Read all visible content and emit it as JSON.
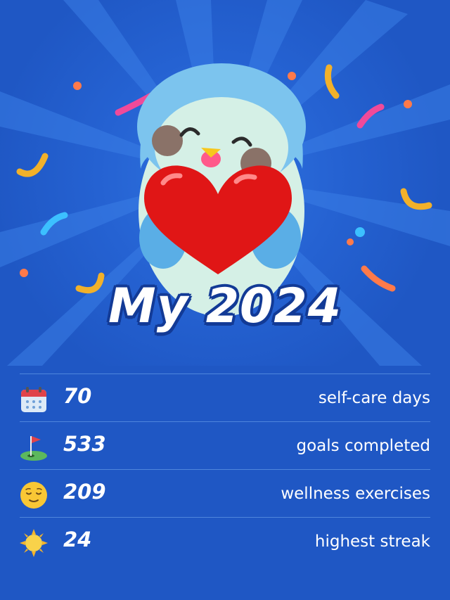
{
  "title": "My 2024",
  "stats": [
    {
      "icon": "calendar-icon",
      "value": "70",
      "label": "self-care days"
    },
    {
      "icon": "golf-flag-icon",
      "value": "533",
      "label": "goals completed"
    },
    {
      "icon": "relieved-face-icon",
      "value": "209",
      "label": "wellness exercises"
    },
    {
      "icon": "sun-icon",
      "value": "24",
      "label": "highest streak"
    }
  ],
  "colors": {
    "background": "#1f57c4",
    "divider": "#4f86dc",
    "heart": "#e01616",
    "bird": "#7cc4ee",
    "title_outline": "#123a96"
  }
}
